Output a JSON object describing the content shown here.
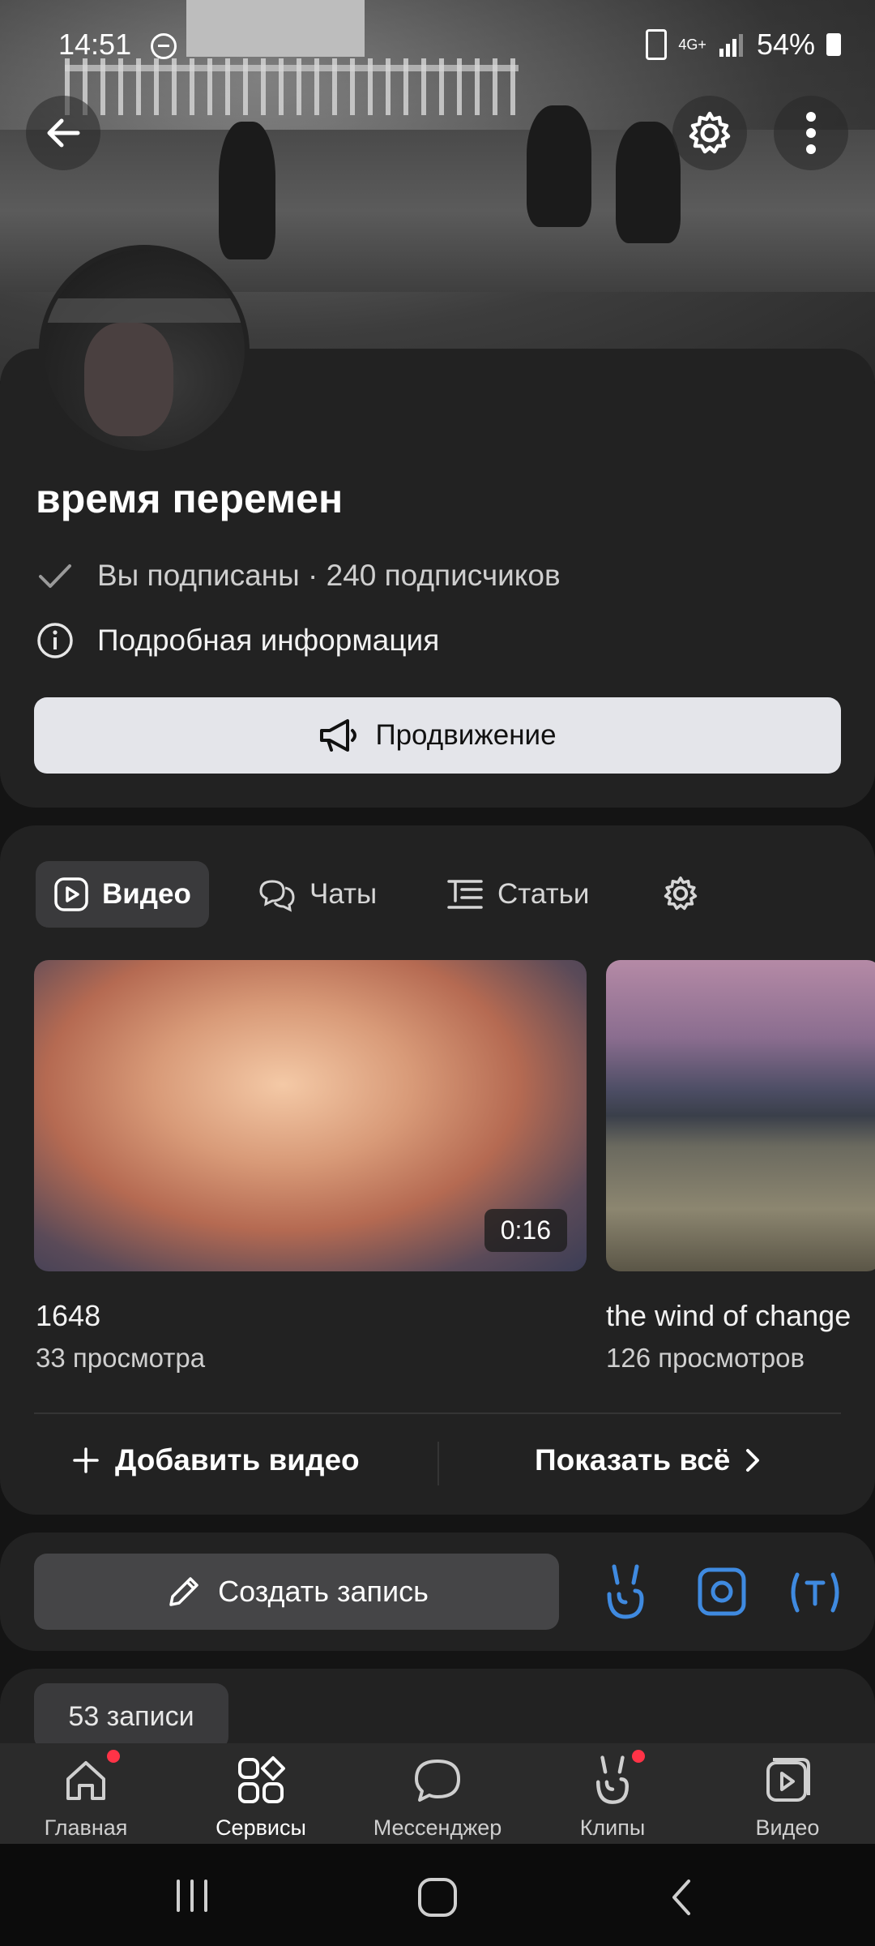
{
  "status_bar": {
    "time": "14:51",
    "network": "4G+",
    "battery": "54%"
  },
  "header": {
    "back": "back-arrow",
    "settings": "gear-icon",
    "more": "more-vertical-icon"
  },
  "profile": {
    "name": "время перемен",
    "subscribed_text": "Вы подписаны · 240 подписчиков",
    "info_text": "Подробная информация",
    "promote_label": "Продвижение"
  },
  "tabs": [
    {
      "label": "Видео",
      "icon": "play-square-icon",
      "active": true
    },
    {
      "label": "Чаты",
      "icon": "chat-bubbles-icon"
    },
    {
      "label": "Статьи",
      "icon": "article-lines-icon"
    }
  ],
  "videos": [
    {
      "title": "1648",
      "views": "33 просмотра",
      "duration": "0:16"
    },
    {
      "title": "the wind of change",
      "views": "126 просмотров"
    }
  ],
  "video_actions": {
    "add": "Добавить видео",
    "show_all": "Показать всё"
  },
  "compose": {
    "create_label": "Создать запись"
  },
  "posts": {
    "count_label": "53 записи"
  },
  "bottom_nav": [
    {
      "label": "Главная",
      "icon": "home-icon",
      "badge": true
    },
    {
      "label": "Сервисы",
      "icon": "services-grid-icon",
      "active": true
    },
    {
      "label": "Мессенджер",
      "icon": "messenger-icon"
    },
    {
      "label": "Клипы",
      "icon": "clips-icon",
      "badge": true
    },
    {
      "label": "Видео",
      "icon": "video-icon"
    }
  ],
  "colors": {
    "accent_blue": "#3f8ae0",
    "badge_red": "#ff3347",
    "card_bg": "#222222"
  }
}
